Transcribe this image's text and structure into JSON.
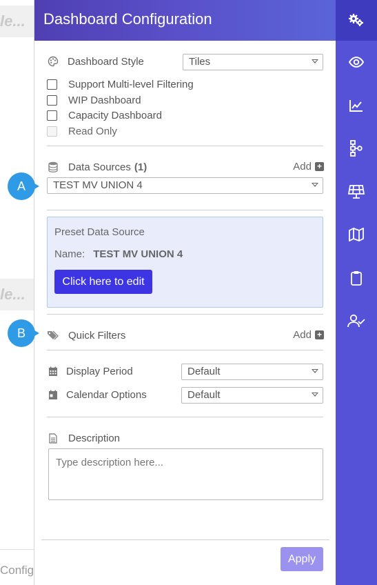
{
  "background": {
    "bar_text_1": "le...",
    "bar_text_2": "le...",
    "bottom_text": "Config"
  },
  "panel": {
    "title": "Dashboard Configuration",
    "dashboard_style": {
      "label": "Dashboard Style",
      "value": "Tiles"
    },
    "checkboxes": [
      {
        "label": "Support Multi-level Filtering",
        "checked": false,
        "disabled": false
      },
      {
        "label": "WIP Dashboard",
        "checked": false,
        "disabled": false
      },
      {
        "label": "Capacity Dashboard",
        "checked": false,
        "disabled": false
      },
      {
        "label": "Read Only",
        "checked": false,
        "disabled": true
      }
    ],
    "data_sources": {
      "label": "Data Sources",
      "count": "(1)",
      "add_label": "Add",
      "selected": "TEST MV UNION 4"
    },
    "preset": {
      "title": "Preset Data Source",
      "name_label": "Name:",
      "name_value": "TEST MV UNION 4",
      "edit_button": "Click here to edit"
    },
    "quick_filters": {
      "label": "Quick Filters",
      "add_label": "Add"
    },
    "display_period": {
      "label": "Display Period",
      "value": "Default"
    },
    "calendar_options": {
      "label": "Calendar Options",
      "value": "Default"
    },
    "description": {
      "label": "Description",
      "placeholder": "Type description here..."
    },
    "apply_button": "Apply"
  },
  "callouts": {
    "a": "A",
    "b": "B"
  },
  "sidenav": {
    "items": [
      "settings-gears-icon",
      "eye-icon",
      "chart-line-icon",
      "hierarchy-icon",
      "solar-panel-icon",
      "map-icon",
      "clipboard-icon",
      "user-check-icon"
    ]
  },
  "colors": {
    "header_gradient_start": "#4f3fb3",
    "header_gradient_end": "#5a64d8",
    "sidenav": "#5652d8",
    "edit_button": "#3d35e3",
    "apply_button": "#9b92f0",
    "callout": "#2f9be6",
    "preset_bg": "#e9ecfb"
  }
}
